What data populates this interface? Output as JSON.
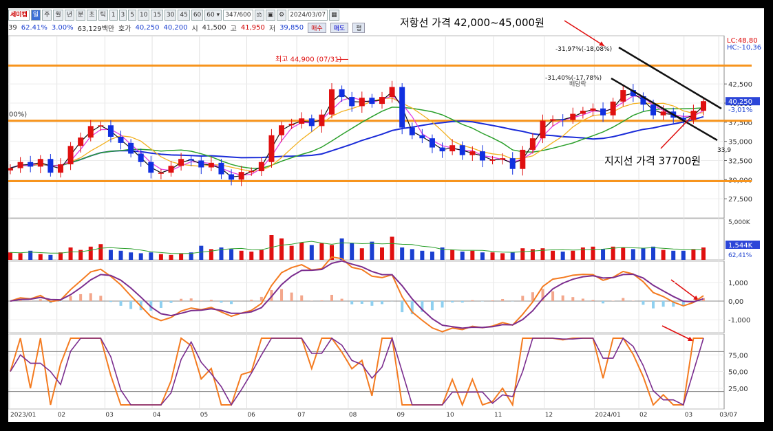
{
  "toolbar": {
    "name": "세미캡",
    "buttons": [
      "일",
      "주",
      "월",
      "년",
      "분",
      "초",
      "틱"
    ],
    "periods": [
      "1",
      "3",
      "5",
      "10",
      "15",
      "30",
      "45",
      "60"
    ],
    "period_select": "60",
    "count": "347/600",
    "date": "2024/03/07"
  },
  "quote": {
    "code_tail": "39",
    "change_pct": "62.41%",
    "rate": "3.00%",
    "amount": "63,129백만",
    "bid_label": "호가",
    "bid1": "40,250",
    "bid2": "40,200",
    "open_label": "시",
    "open": "41,500",
    "high_label": "고",
    "high": "41,950",
    "low_label": "저",
    "low": "39,850",
    "buy": "매수",
    "sell": "매도",
    "avg": "평"
  },
  "annotations": {
    "resistance": "저항선 가격 42,000~45,000원",
    "support": "지지선 가격 37700원"
  },
  "chart_data": [
    {
      "type": "candlestick",
      "x_ticks": [
        "2023/01",
        "02",
        "03",
        "04",
        "05",
        "06",
        "07",
        "08",
        "09",
        "10",
        "11",
        "12",
        "2024/01",
        "02",
        "03",
        "03/07"
      ],
      "y_ticks": [
        "42,500",
        "40,000",
        "37,500",
        "35,000",
        "32,500",
        "30,000",
        "27,500"
      ],
      "ylim": [
        25000,
        48800
      ],
      "last_price_label": "40,250",
      "last_price": 40250,
      "last_pct_label": "-3,01%",
      "lc_label": "LC:48,80",
      "hc_label": "HC:-10,36",
      "left_label": "00%)",
      "high_note": "최고 44,900 (07/31)",
      "low_note": "33,9",
      "note1": "-31,97%(-18,08%)",
      "note2": "-31,40%(-17,78%)",
      "note3": "배당락",
      "horizontal_lines": [
        44900,
        37700,
        29800
      ],
      "close": [
        31500,
        32300,
        31700,
        32700,
        30900,
        32000,
        34400,
        35500,
        37000,
        37100,
        35600,
        34800,
        33400,
        32300,
        30900,
        30900,
        31800,
        32700,
        32500,
        31600,
        32200,
        30700,
        30000,
        31000,
        31100,
        32300,
        35800,
        37100,
        37300,
        38000,
        37000,
        38500,
        41800,
        40800,
        39600,
        40700,
        39900,
        40800,
        42100,
        36800,
        35800,
        35400,
        34200,
        33700,
        34500,
        33200,
        33700,
        32500,
        32600,
        32800,
        31400,
        33900,
        35400,
        37700,
        37900,
        37800,
        38600,
        39000,
        39300,
        38400,
        40200,
        41700,
        40900,
        39800,
        38400,
        38900,
        38100,
        37800,
        39000,
        40250
      ],
      "volume": [
        0.9,
        0.8,
        1.1,
        0.7,
        0.6,
        0.9,
        1.5,
        1.2,
        1.6,
        1.9,
        1.2,
        1.1,
        0.9,
        0.8,
        0.9,
        0.7,
        0.6,
        0.8,
        0.9,
        1.7,
        1.3,
        1.5,
        1.3,
        1.1,
        1.0,
        1.2,
        3.0,
        2.6,
        1.7,
        2.1,
        1.8,
        2.0,
        1.8,
        2.6,
        2.0,
        1.4,
        2.2,
        1.5,
        2.8,
        1.5,
        1.3,
        1.1,
        1.0,
        1.5,
        1.2,
        1.0,
        1.1,
        0.9,
        0.9,
        0.8,
        0.9,
        1.4,
        1.3,
        1.4,
        1.1,
        1.0,
        1.1,
        1.5,
        1.6,
        1.3,
        1.6,
        1.5,
        1.3,
        1.4,
        1.6,
        1.2,
        1.1,
        1.1,
        1.3,
        1.5
      ],
      "vol_ticks": [
        "5,000K"
      ],
      "vol_last_label": "1,544K",
      "vol_pct_label": "62,41%",
      "macd_ticks": [
        "1,000",
        "0,00",
        "-1,000"
      ],
      "macd_last": -350,
      "stoch_ticks": [
        "75,00",
        "50,00",
        "25,00"
      ],
      "stoch_last": 82
    }
  ]
}
